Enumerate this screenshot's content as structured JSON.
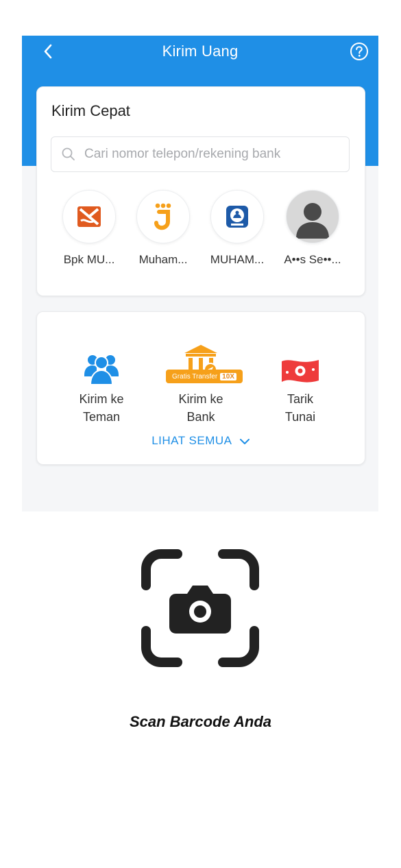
{
  "header": {
    "title": "Kirim Uang",
    "background_color": "#1f8fe6"
  },
  "quick_send": {
    "title": "Kirim Cepat",
    "search_placeholder": "Cari nomor telepon/rekening bank",
    "search_value": "",
    "contacts": [
      {
        "name": "Bpk MU...",
        "icon": "bank-logo-orange"
      },
      {
        "name": "Muham...",
        "icon": "jenius-logo"
      },
      {
        "name": "MUHAM...",
        "icon": "bank-logo-blue"
      },
      {
        "name": "A••s Se••...",
        "icon": "person-avatar"
      }
    ]
  },
  "menu": {
    "items": [
      {
        "label_line1": "Kirim ke",
        "label_line2": "Teman",
        "icon": "friends-icon"
      },
      {
        "label_line1": "Kirim ke",
        "label_line2": "Bank",
        "icon": "bank-transfer-icon",
        "badge_text": "Gratis Transfer",
        "badge_value": "10X"
      },
      {
        "label_line1": "Tarik",
        "label_line2": "Tunai",
        "icon": "cash-icon"
      }
    ],
    "see_all": "LIHAT SEMUA"
  },
  "scan": {
    "label": "Scan Barcode Anda"
  }
}
